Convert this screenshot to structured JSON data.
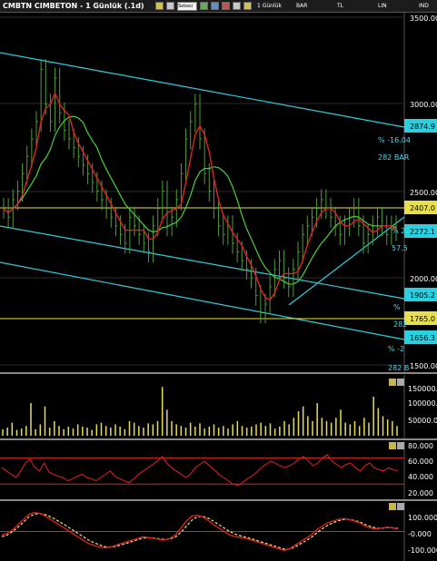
{
  "window": {
    "title": "CMBTN CIMBETON - 1 Günlük (.1d)"
  },
  "toolbar": {
    "items": [
      {
        "name": "period",
        "label": "1 Günlük"
      },
      {
        "name": "bar",
        "label": "BAR"
      },
      {
        "name": "tl",
        "label": "TL"
      },
      {
        "name": "lin",
        "label": "LIN"
      },
      {
        "name": "ind",
        "label": "IND"
      }
    ],
    "field_label": "Sekesi"
  },
  "colors": {
    "background": "#000000",
    "price_bars": "#4c9f38",
    "ma_fast": "#e52020",
    "ma_slow": "#4ccf3c",
    "channel": "#29d0e0",
    "hline": "#e8e04a",
    "volume": "#e8e04a",
    "rsi": "#e52020",
    "macd": "#e52020",
    "macd_signal": "#ffe066",
    "band": "#e52020"
  },
  "chart_data": [
    {
      "type": "line",
      "panel": "price",
      "ylim": [
        1500,
        3500
      ],
      "yticks": [
        "3500.000",
        "3000.000",
        "2500.000",
        "2000.000",
        "1500.000"
      ],
      "series": [
        {
          "name": "",
          "type": "ohlc",
          "x": [
            0,
            5,
            10,
            15,
            20,
            25,
            30,
            35,
            40,
            45,
            50,
            55,
            60,
            65,
            70,
            75,
            80,
            85,
            90,
            95,
            100,
            105,
            110,
            115,
            120,
            125,
            130,
            135,
            140,
            145,
            150,
            155,
            160,
            165,
            170,
            175,
            180,
            185,
            190,
            195,
            200,
            205,
            210,
            215,
            220,
            225,
            230,
            235,
            240,
            245,
            250,
            255,
            260,
            265,
            270,
            275,
            280,
            285,
            290,
            295,
            300,
            305,
            310,
            315,
            320,
            325,
            330,
            335,
            340,
            345,
            350,
            355,
            360,
            365,
            370,
            375,
            380,
            385,
            390,
            395,
            400,
            405,
            410,
            415,
            420
          ],
          "close": [
            2400,
            2350,
            2450,
            2500,
            2600,
            2700,
            2800,
            2900,
            3200,
            3000,
            2900,
            3150,
            2950,
            2850,
            2800,
            2750,
            2700,
            2650,
            2600,
            2550,
            2500,
            2450,
            2400,
            2350,
            2300,
            2250,
            2200,
            2350,
            2300,
            2250,
            2200,
            2150,
            2300,
            2400,
            2500,
            2300,
            2350,
            2450,
            2600,
            2800,
            2900,
            3000,
            2800,
            2600,
            2500,
            2400,
            2300,
            2250,
            2300,
            2200,
            2150,
            2100,
            2050,
            2000,
            1900,
            1800,
            1850,
            1950,
            2050,
            2100,
            2000,
            1950,
            2050,
            2150,
            2250,
            2300,
            2350,
            2400,
            2450,
            2400,
            2350,
            2300,
            2250,
            2300,
            2350,
            2400,
            2300,
            2200,
            2250,
            2300,
            2350,
            2300,
            2250,
            2300,
            2272
          ]
        }
      ]
    },
    {
      "type": "bar",
      "panel": "volume",
      "ylim": [
        0,
        170000
      ],
      "yticks": [
        "150000.0",
        "100000.0",
        "50000.0"
      ],
      "values": [
        20000,
        25000,
        40000,
        18000,
        22000,
        30000,
        100000,
        20000,
        35000,
        90000,
        25000,
        45000,
        30000,
        20000,
        28000,
        22000,
        35000,
        28000,
        25000,
        18000,
        35000,
        40000,
        30000,
        25000,
        35000,
        28000,
        20000,
        45000,
        40000,
        30000,
        25000,
        38000,
        35000,
        45000,
        150000,
        80000,
        45000,
        35000,
        30000,
        25000,
        40000,
        28000,
        38000,
        22000,
        28000,
        35000,
        25000,
        30000,
        22000,
        35000,
        45000,
        30000,
        25000,
        28000,
        35000,
        40000,
        30000,
        38000,
        22000,
        28000,
        45000,
        35000,
        55000,
        75000,
        90000,
        60000,
        45000,
        100000,
        55000,
        45000,
        40000,
        55000,
        80000,
        40000,
        35000,
        45000,
        30000,
        55000,
        40000,
        120000,
        85000,
        60000,
        50000,
        45000,
        30000
      ]
    },
    {
      "type": "line",
      "panel": "rsi",
      "ylim": [
        15,
        90
      ],
      "yticks": [
        "80.000",
        "60.000",
        "40.000",
        "20.000"
      ],
      "bands": [
        70,
        30
      ],
      "values": [
        55,
        50,
        45,
        40,
        50,
        62,
        68,
        55,
        50,
        62,
        48,
        45,
        42,
        40,
        35,
        38,
        42,
        45,
        40,
        38,
        35,
        40,
        45,
        50,
        42,
        38,
        35,
        32,
        38,
        45,
        50,
        55,
        60,
        65,
        72,
        62,
        55,
        50,
        45,
        40,
        45,
        55,
        60,
        65,
        58,
        52,
        45,
        40,
        35,
        30,
        28,
        32,
        38,
        42,
        48,
        55,
        60,
        65,
        62,
        58,
        55,
        58,
        62,
        68,
        72,
        65,
        58,
        62,
        70,
        75,
        65,
        60,
        55,
        60,
        62,
        55,
        50,
        58,
        62,
        55,
        52,
        50,
        55,
        52,
        50
      ]
    },
    {
      "type": "line",
      "panel": "macd",
      "ylim": [
        -150,
        150
      ],
      "yticks": [
        "100.000",
        "-0.000",
        "-100.000"
      ],
      "series": [
        {
          "name": "",
          "values": [
            -20,
            -10,
            10,
            40,
            70,
            100,
            110,
            105,
            90,
            70,
            50,
            30,
            10,
            -10,
            -30,
            -50,
            -70,
            -80,
            -90,
            -95,
            -90,
            -80,
            -70,
            -60,
            -50,
            -40,
            -30,
            -35,
            -40,
            -45,
            -50,
            -40,
            -20,
            20,
            60,
            90,
            95,
            85,
            65,
            40,
            20,
            0,
            -20,
            -30,
            -35,
            -40,
            -50,
            -60,
            -70,
            -80,
            -90,
            -100,
            -110,
            -100,
            -80,
            -60,
            -40,
            -20,
            10,
            30,
            50,
            60,
            70,
            75,
            70,
            60,
            50,
            30,
            20,
            15,
            20,
            25,
            20,
            15
          ]
        },
        {
          "name": "",
          "values": [
            -30,
            -20,
            0,
            25,
            55,
            85,
            100,
            105,
            98,
            85,
            68,
            50,
            30,
            10,
            -10,
            -30,
            -50,
            -65,
            -78,
            -88,
            -90,
            -86,
            -78,
            -68,
            -58,
            -48,
            -38,
            -36,
            -38,
            -42,
            -46,
            -43,
            -32,
            -5,
            30,
            65,
            85,
            88,
            78,
            60,
            40,
            20,
            0,
            -15,
            -25,
            -33,
            -42,
            -52,
            -62,
            -72,
            -82,
            -92,
            -102,
            -102,
            -90,
            -72,
            -54,
            -35,
            -10,
            15,
            35,
            50,
            62,
            70,
            70,
            64,
            55,
            40,
            28,
            20,
            18,
            22,
            22,
            18
          ]
        }
      ],
      "zero_line": 0
    }
  ],
  "price_labels": [
    {
      "id": "3500",
      "text": "3500.000"
    },
    {
      "id": "2874",
      "text": "2874.9"
    },
    {
      "id": "2407",
      "text": "2407.0"
    },
    {
      "id": "2272",
      "text": "2272.1"
    },
    {
      "id": "1905",
      "text": "1905.2"
    },
    {
      "id": "1765",
      "text": "1765.0"
    },
    {
      "id": "1656",
      "text": "1656.3"
    }
  ],
  "annotations": {
    "pct_top": "% -16.04",
    "bars_top": "282 BAR",
    "pct_mid": "% 2",
    "num_mid": "57.5",
    "pct_low": "%",
    "bars_low": "282",
    "pct_bottom": "% -2",
    "bars_bottom": "282 B"
  }
}
